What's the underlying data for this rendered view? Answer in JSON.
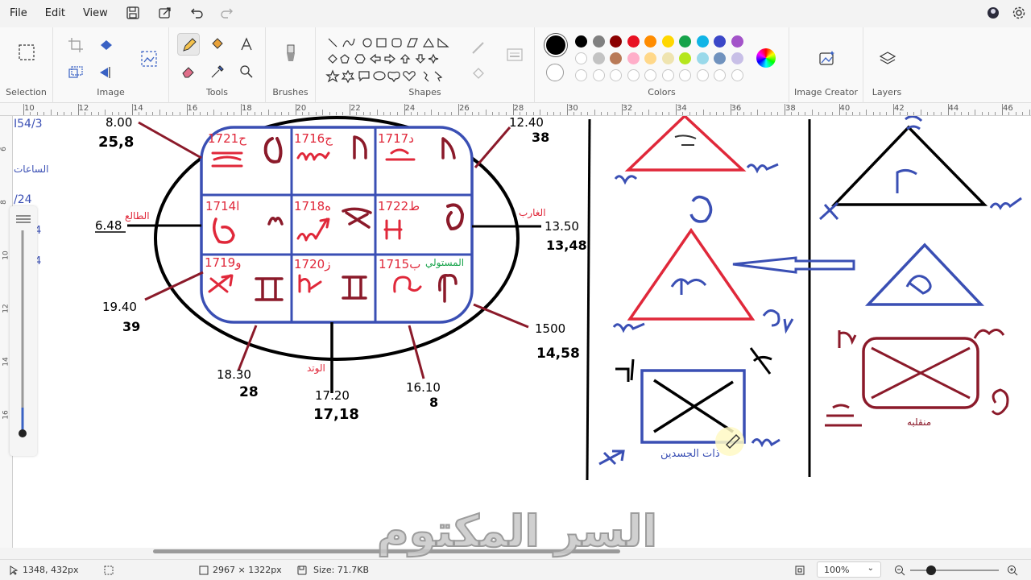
{
  "menu": {
    "file": "File",
    "edit": "Edit",
    "view": "View"
  },
  "ribbon": {
    "selection": "Selection",
    "image": "Image",
    "tools": "Tools",
    "brushes": "Brushes",
    "shapes": "Shapes",
    "colors": "Colors",
    "image_creator": "Image Creator",
    "layers": "Layers"
  },
  "palette_row1": [
    "#000000",
    "#808080",
    "#8b0000",
    "#e81123",
    "#ff8c00",
    "#ffd700",
    "#16a34a",
    "#10b4e6",
    "#3b47c8",
    "#a353c9"
  ],
  "palette_row2": [
    "#ffffff",
    "#c3c3c3",
    "#b97a57",
    "#ffaec9",
    "#ffd88a",
    "#efe4b0",
    "#b5e61d",
    "#99d9ea",
    "#7092be",
    "#c8bfe7"
  ],
  "ruler_h": [
    "10",
    "12",
    "14",
    "16",
    "18",
    "20",
    "22",
    "24",
    "26",
    "28",
    "30",
    "32",
    "34",
    "36",
    "38",
    "40",
    "42",
    "44",
    "46"
  ],
  "ruler_v": [
    "6",
    "8",
    "10",
    "12",
    "14",
    "16"
  ],
  "drawing": {
    "left_margin": [
      "I54/3",
      "الساعات",
      "/24",
      "4",
      "4"
    ],
    "cells": [
      "1721ح",
      "1716ج",
      "1717د",
      "1714ا",
      "1718ه",
      "1722ط",
      "1719و",
      "1720ز",
      "1715ب"
    ],
    "cell_label_mustawli": "المستولي",
    "times": {
      "t800": "8.00",
      "t800b": "25,8",
      "t1240": "12.40",
      "t1240b": "38",
      "t648": "6.48",
      "t648_label": "الطالع",
      "t1350": "13.50",
      "t1350b": "13,48",
      "t1350_label": "الغارب",
      "t1940": "19.40",
      "t1940b": "39",
      "t1500": "1500",
      "t1500b": "14,58",
      "t1830": "18.30",
      "t1830b": "28",
      "t1720": "17.20",
      "t1720b": "17,18",
      "t1720_label": "الوتد",
      "t1610": "16.10",
      "t1610b": "8"
    },
    "dhat_aljasadayn": "ذات الجسدين",
    "munqaliba": "منقلبه"
  },
  "status": {
    "cursor": "1348, 432px",
    "canvas_size": "2967 × 1322px",
    "file_size": "Size: 71.7KB",
    "zoom": "100%"
  },
  "watermark": "السر المكتوم"
}
